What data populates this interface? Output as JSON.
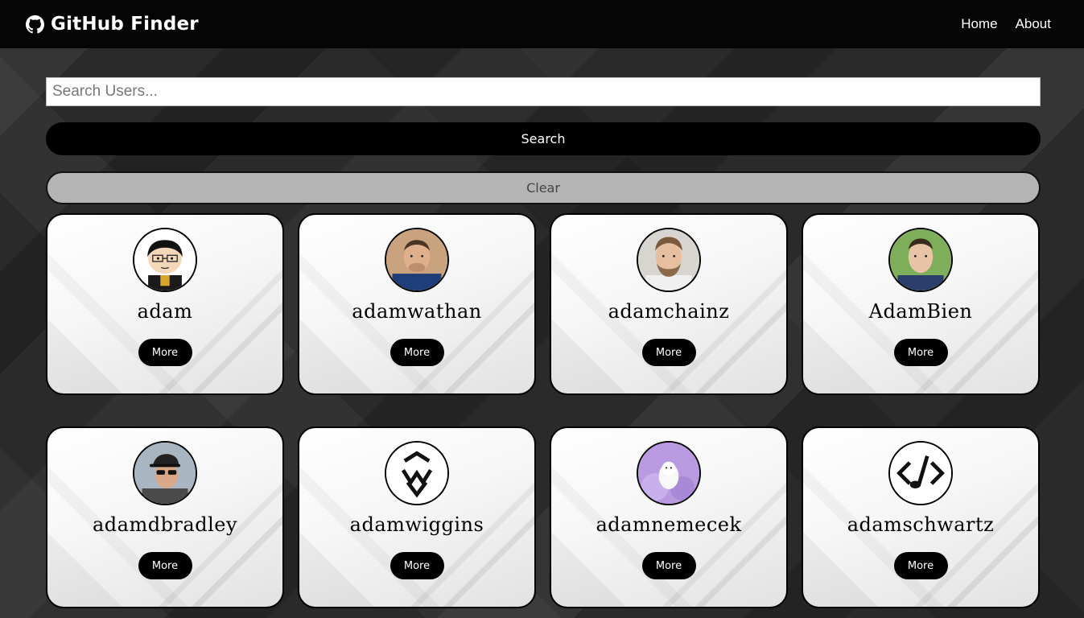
{
  "navbar": {
    "brand_icon": "github-icon",
    "title": "GitHub Finder",
    "links": [
      "Home",
      "About"
    ]
  },
  "search": {
    "placeholder": "Search Users...",
    "value": "",
    "search_label": "Search",
    "clear_label": "Clear"
  },
  "users": [
    {
      "login": "adam",
      "more_label": "More"
    },
    {
      "login": "adamwathan",
      "more_label": "More"
    },
    {
      "login": "adamchainz",
      "more_label": "More"
    },
    {
      "login": "AdamBien",
      "more_label": "More"
    },
    {
      "login": "adamdbradley",
      "more_label": "More"
    },
    {
      "login": "adamwiggins",
      "more_label": "More"
    },
    {
      "login": "adamnemecek",
      "more_label": "More"
    },
    {
      "login": "adamschwartz",
      "more_label": "More"
    }
  ],
  "colors": {
    "navbar_bg": "#050505",
    "primary_button": "#000000",
    "clear_button": "#b4b4b4",
    "card_border": "#000000"
  }
}
